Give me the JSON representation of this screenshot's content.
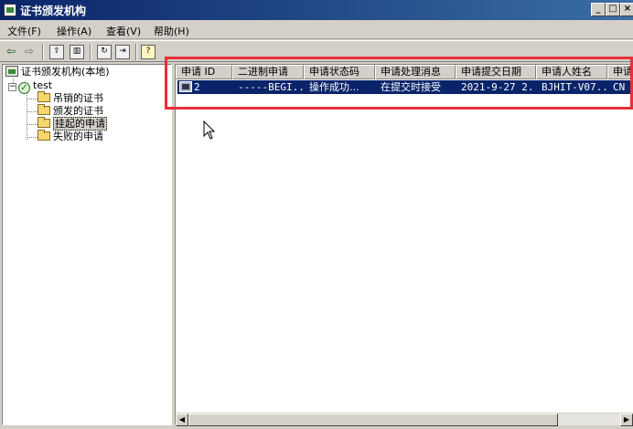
{
  "window": {
    "title": "证书颁发机构",
    "min": "_",
    "max": "□",
    "close": "×"
  },
  "menu": [
    {
      "label": "文件(F)"
    },
    {
      "label": "操作(A)"
    },
    {
      "label": "查看(V)"
    },
    {
      "label": "帮助(H)"
    }
  ],
  "toolbar_icons": [
    "back-arrow-icon",
    "forward-arrow-icon",
    "up-folder-icon",
    "show-hide-tree-icon",
    "refresh-icon",
    "export-list-icon",
    "help-icon"
  ],
  "tree": {
    "root": "证书颁发机构(本地)",
    "ca": "test",
    "items": [
      {
        "label": "吊销的证书"
      },
      {
        "label": "颁发的证书"
      },
      {
        "label": "挂起的申请"
      },
      {
        "label": "失败的申请"
      }
    ],
    "selected_index": 2,
    "expander": "−"
  },
  "list": {
    "columns": [
      "申请 ID",
      "二进制申请",
      "申请状态码",
      "申请处理消息",
      "申请提交日期",
      "申请人姓名",
      "申请"
    ],
    "rows": [
      {
        "cells": [
          "2",
          "-----BEGI...",
          "操作成功...",
          "在提交时接受",
          "2021-9-27 2...",
          "BJHIT-V07...",
          "CN"
        ]
      }
    ]
  },
  "scrollbar": {
    "left": "◀",
    "right": "▶"
  },
  "colors": {
    "title_bar": "#0a246a",
    "selection": "#0a246a",
    "highlight_box": "#e8303a"
  }
}
